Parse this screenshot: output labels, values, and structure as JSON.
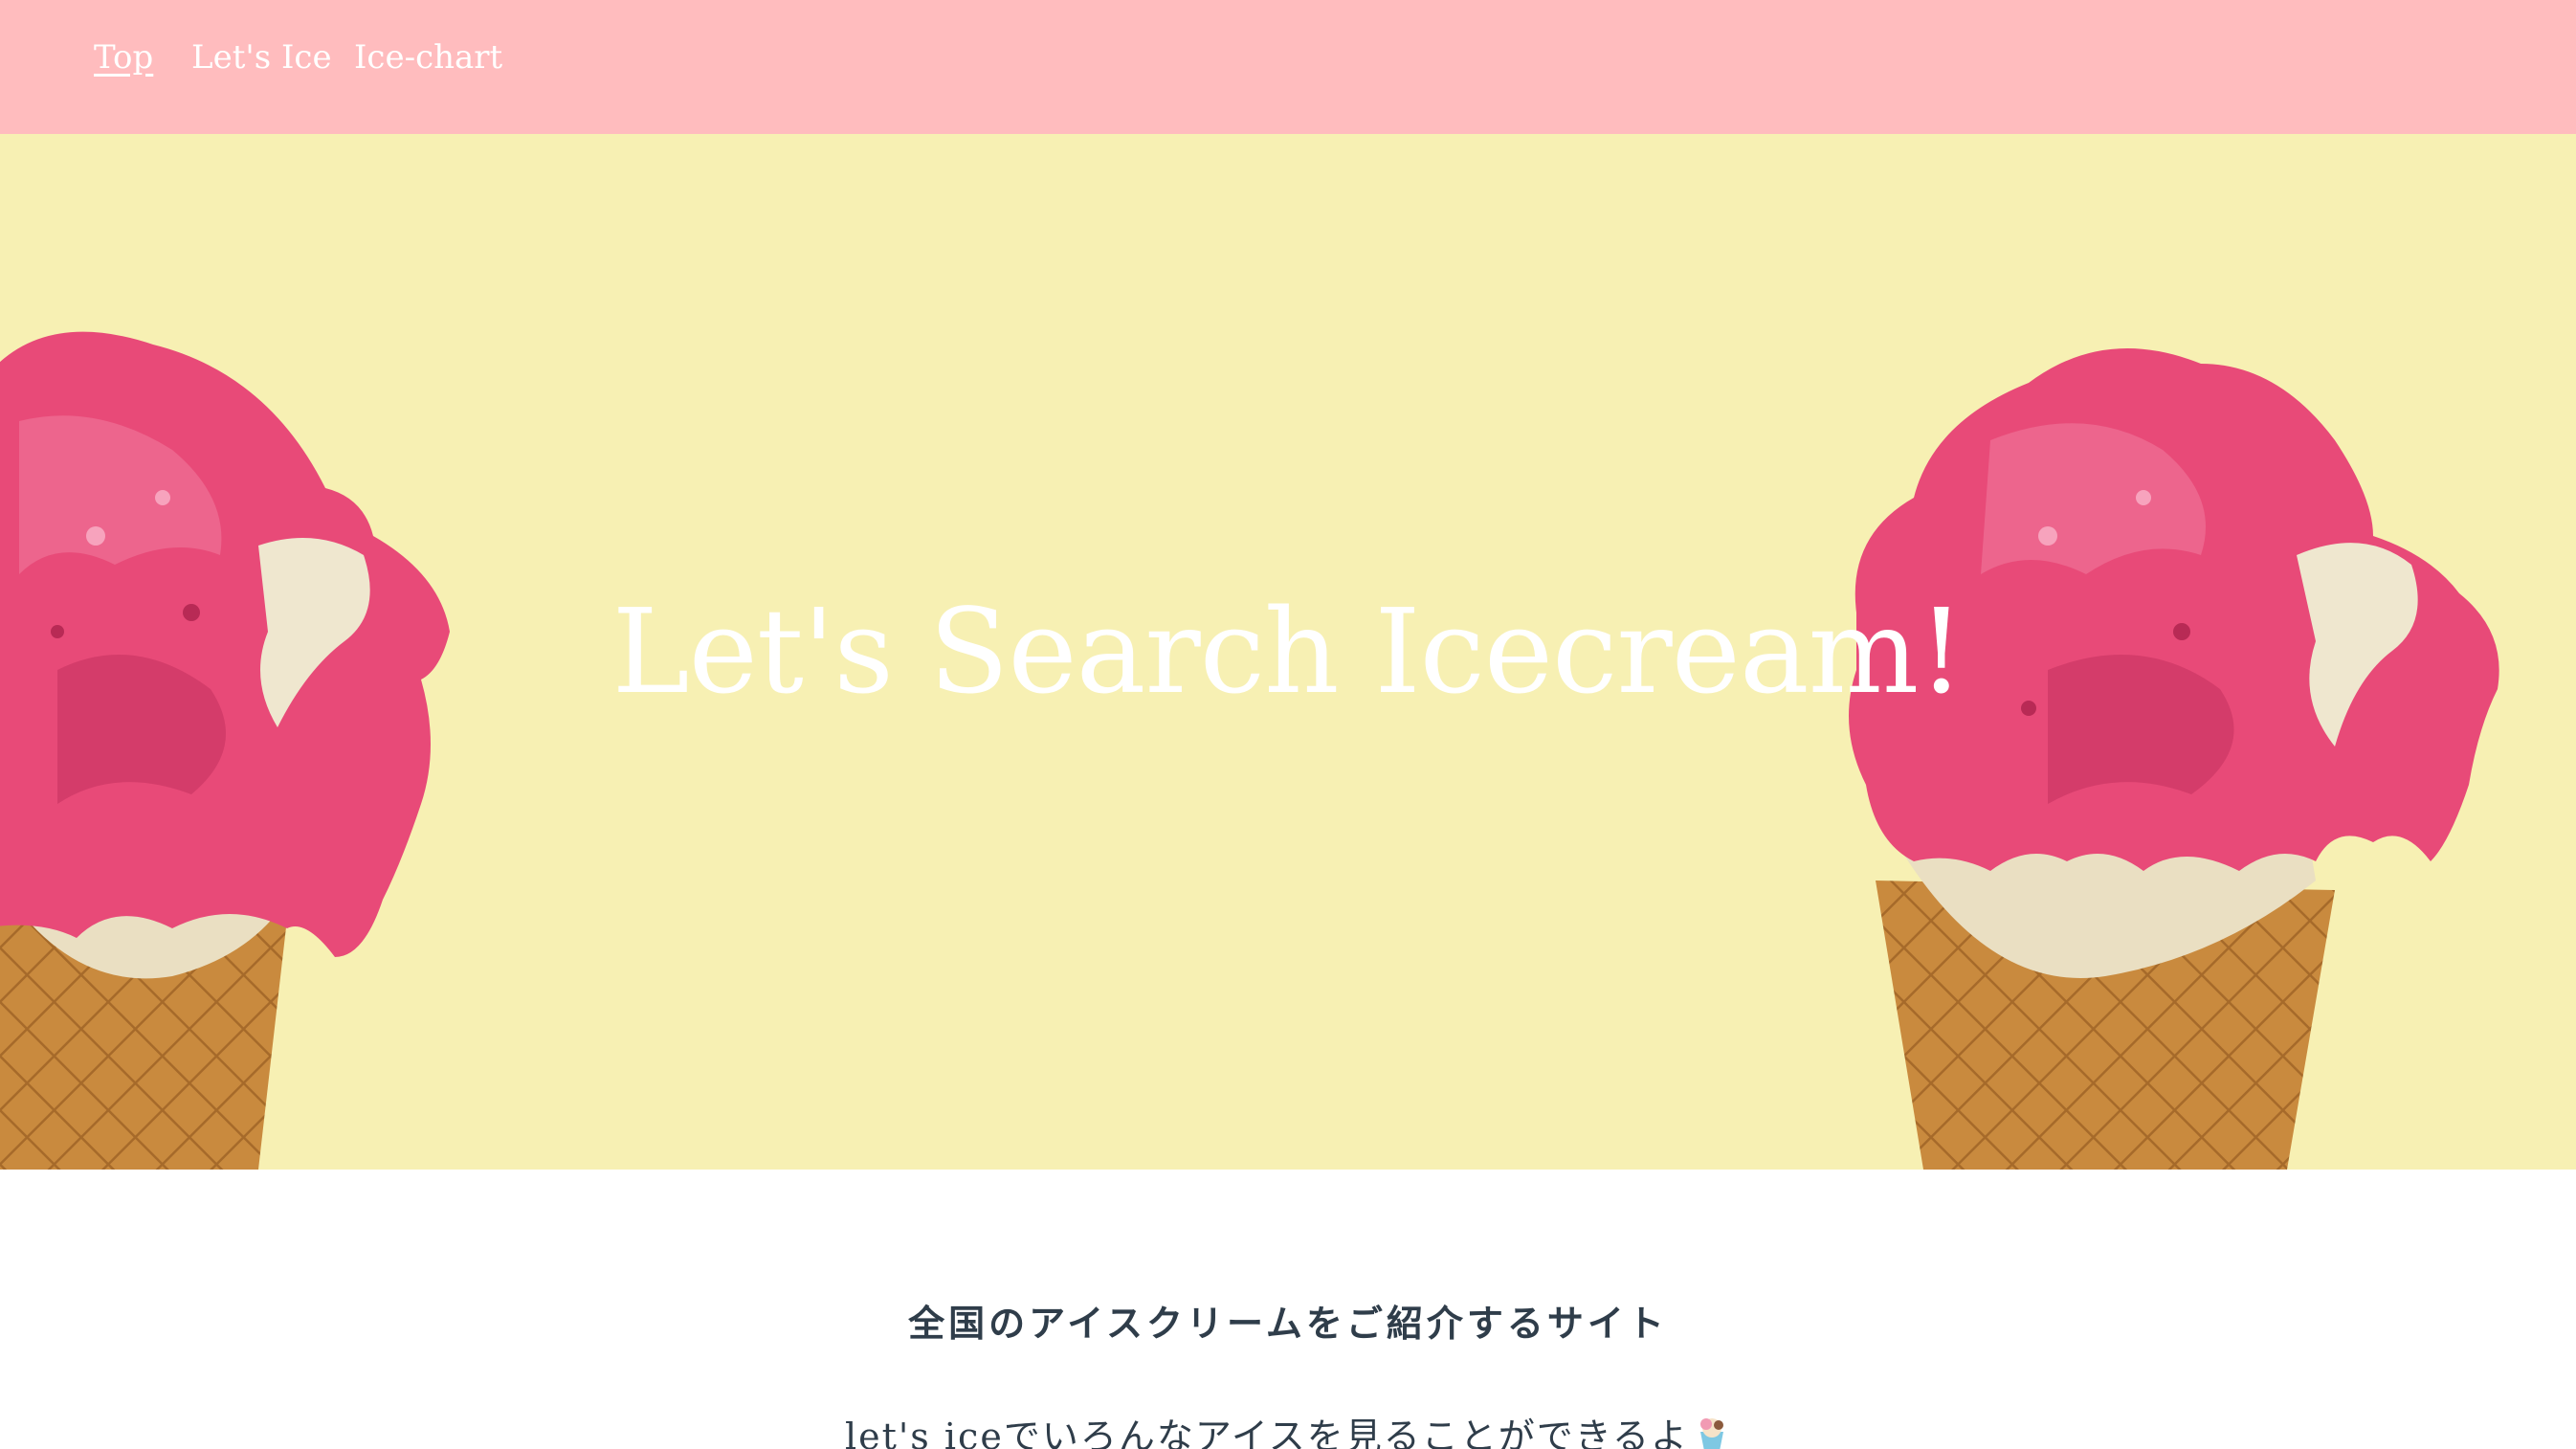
{
  "nav": {
    "items": [
      {
        "label": "Top",
        "active": true
      },
      {
        "label": "Let's Ice",
        "active": false
      },
      {
        "label": "Ice-chart",
        "active": false
      }
    ]
  },
  "hero": {
    "title": "Let's Search Icecream!",
    "images": [
      "ice-cream-cone-icon",
      "ice-cream-cone-icon"
    ]
  },
  "content": {
    "tagline": "全国のアイスクリームをご紹介するサイト",
    "description": "let's iceでいろんなアイスを見ることができるよ",
    "description_icon": "ice-cream-emoji-icon"
  },
  "colors": {
    "navbar": "#ffbcbe",
    "hero_bg": "#f7f0b3",
    "scoop": "#e84a78",
    "cone": "#c98a3e",
    "text": "#2f3d4a"
  }
}
